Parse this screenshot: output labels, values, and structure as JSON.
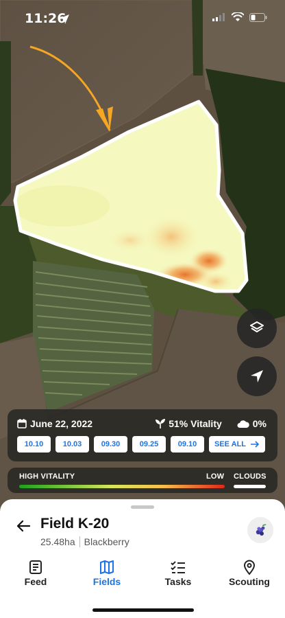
{
  "status_bar": {
    "time": "11:26"
  },
  "map": {
    "attribution_colors": {
      "accent": "#f5a623"
    }
  },
  "imagery": {
    "date": "June 22, 2022",
    "vitality": "51% Vitality",
    "clouds": "0%",
    "dates": [
      "10.10",
      "10.03",
      "09.30",
      "09.25",
      "09.10"
    ],
    "see_all": "SEE ALL"
  },
  "legend": {
    "high": "HIGH VITALITY",
    "low": "LOW",
    "clouds": "CLOUDS"
  },
  "field": {
    "name": "Field K-20",
    "area": "25.48ha",
    "crop": "Blackberry"
  },
  "tabs": [
    {
      "label": "Feed",
      "icon": "document-icon"
    },
    {
      "label": "Fields",
      "icon": "map-icon"
    },
    {
      "label": "Tasks",
      "icon": "checklist-icon"
    },
    {
      "label": "Scouting",
      "icon": "location-pin-icon"
    }
  ],
  "active_tab": "Fields",
  "colors": {
    "active": "#1a73e8",
    "inactive": "#222222"
  }
}
